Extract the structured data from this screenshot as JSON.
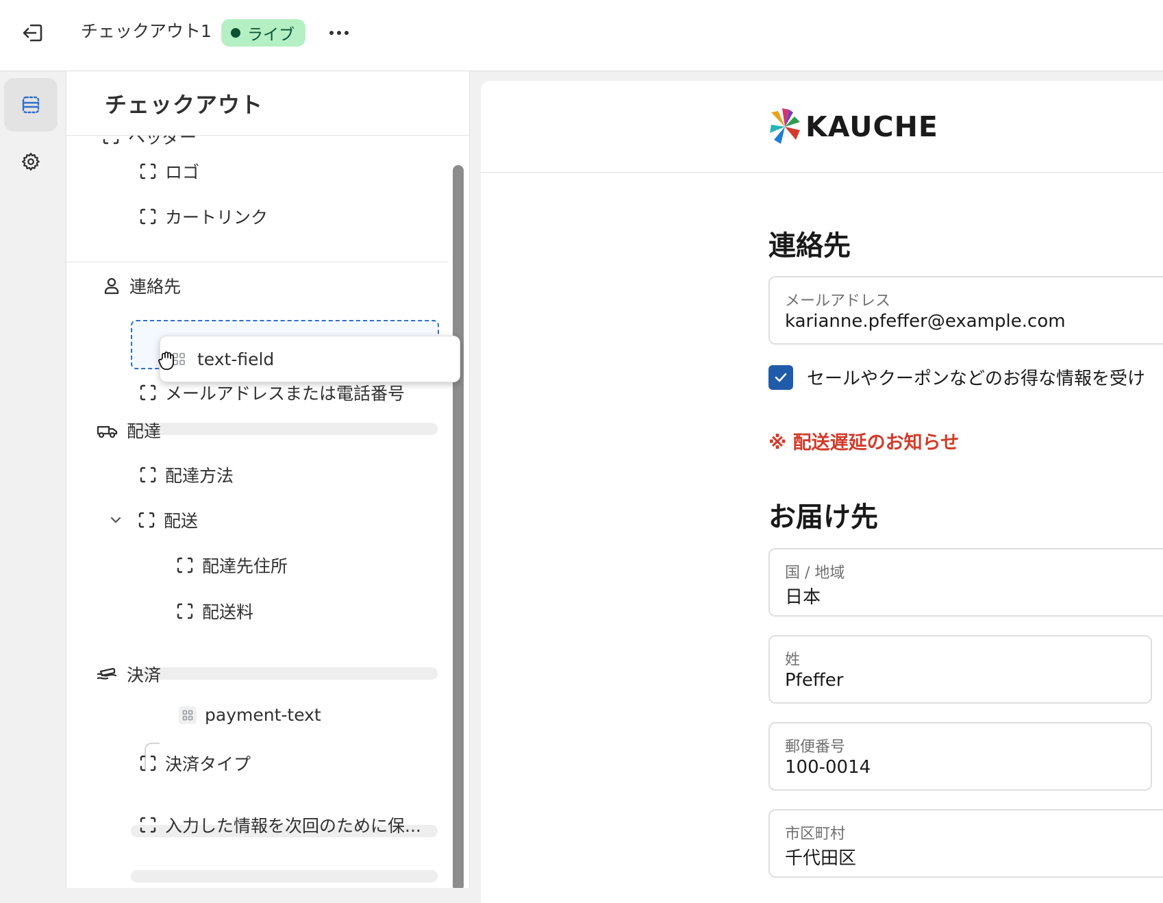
{
  "topbar": {
    "title": "チェックアウト1",
    "status_badge": "ライブ"
  },
  "sidebar": {
    "title": "チェックアウト",
    "items": {
      "header_partial": "ヘッダー",
      "logo": "ロゴ",
      "cart_link": "カートリンク",
      "contact": "連絡先",
      "email_or_phone": "メールアドレスまたは電話番号",
      "delivery": "配達",
      "delivery_method": "配達方法",
      "shipping": "配送",
      "shipping_address": "配達先住所",
      "shipping_fee": "配送料",
      "payment": "決済",
      "payment_text": "payment-text",
      "payment_type": "決済タイプ",
      "save_info": "入力した情報を次回のために保..."
    },
    "drag_card": "text-field"
  },
  "preview": {
    "logo_text": "KAUCHE",
    "contact_heading": "連絡先",
    "email_label": "メールアドレス",
    "email_value": "karianne.pfeffer@example.com",
    "marketing_checkbox_label": "セールやクーポンなどのお得な情報を受け",
    "marketing_checked": true,
    "notice": "※ 配送遅延のお知らせ",
    "shipping_heading": "お届け先",
    "fields": [
      {
        "label": "国 / 地域",
        "value": "日本"
      },
      {
        "label": "姓",
        "value": "Pfeffer"
      },
      {
        "label": "郵便番号",
        "value": "100-0014"
      },
      {
        "label": "市区町村",
        "value": "千代田区"
      }
    ]
  },
  "colors": {
    "accent_blue": "#2c6ecb",
    "badge_bg": "#b4f0c3",
    "notice_red": "#d23b2a"
  },
  "icons": [
    "exit-icon",
    "more-icon",
    "sections-icon",
    "gear-icon",
    "block-icon",
    "person-icon",
    "truck-icon",
    "payment-icon",
    "chevron-down-icon",
    "app-block-icon",
    "grab-cursor-icon",
    "checkmark-icon",
    "kauche-logo-mark"
  ]
}
